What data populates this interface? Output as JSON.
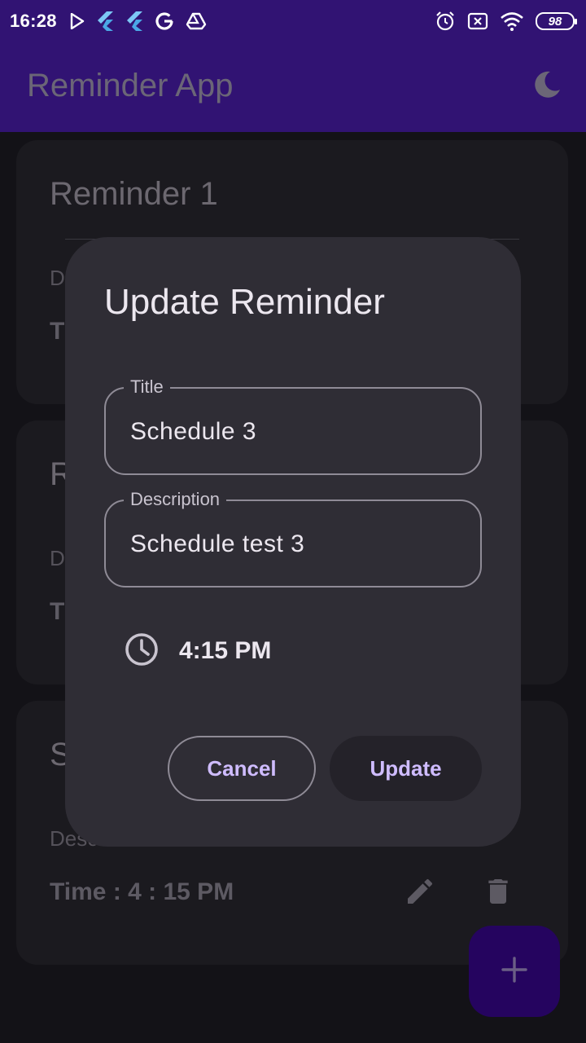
{
  "status_bar": {
    "time": "16:28",
    "battery": "98",
    "left_icons": [
      "play-store-icon",
      "flutter-icon",
      "flutter-icon",
      "google-icon",
      "drive-icon"
    ],
    "right_icons": [
      "alarm-icon",
      "no-sim-icon",
      "wifi-icon",
      "battery-icon"
    ]
  },
  "app_bar": {
    "title": "Reminder App",
    "theme_toggle_icon": "moon-icon"
  },
  "cards": [
    {
      "title": "Reminder 1",
      "sub": "D",
      "time": "T"
    },
    {
      "title": "R",
      "sub": "D",
      "time": "T"
    },
    {
      "title": "S",
      "sub": "Desc",
      "time": "Time : 4 : 15  PM"
    }
  ],
  "dialog": {
    "title": "Update Reminder",
    "title_field": {
      "label": "Title",
      "value": "Schedule 3"
    },
    "description_field": {
      "label": "Description",
      "value": "Schedule test 3"
    },
    "time": "4:15 PM",
    "cancel_label": "Cancel",
    "update_label": "Update"
  },
  "fab": {
    "icon": "plus-icon"
  },
  "colors": {
    "app_bar": "#311373",
    "background": "#131217",
    "dialog": "#2f2d35",
    "accent": "#cfbcff",
    "fab": "#25045f"
  }
}
